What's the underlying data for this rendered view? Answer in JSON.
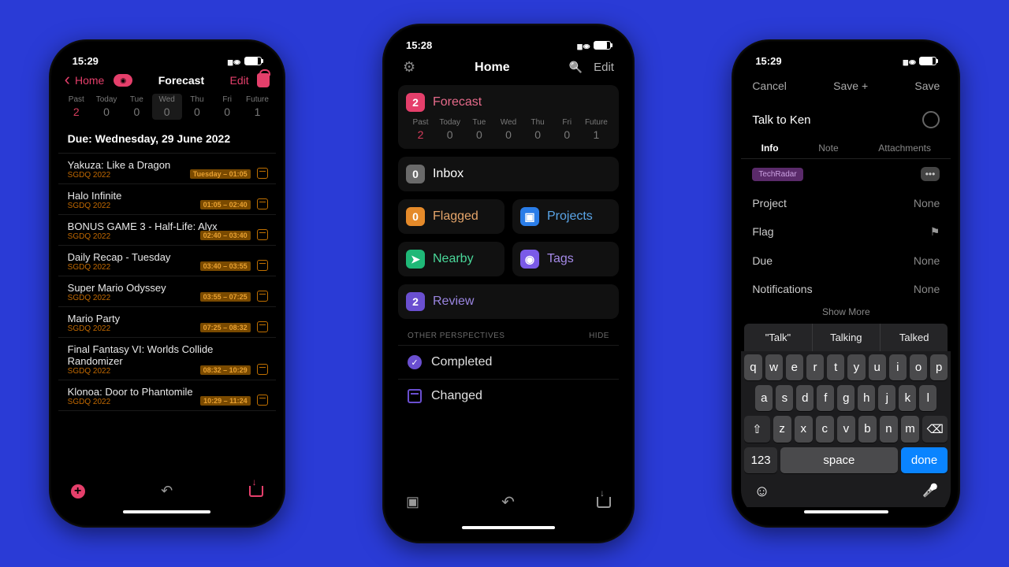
{
  "phone1": {
    "status_time": "15:29",
    "nav": {
      "back": "Home",
      "title": "Forecast",
      "edit": "Edit"
    },
    "days": [
      {
        "label": "Past",
        "num": "2",
        "cls": "past"
      },
      {
        "label": "Today",
        "num": "0"
      },
      {
        "label": "Tue",
        "num": "0"
      },
      {
        "label": "Wed",
        "num": "0",
        "cls": "sel"
      },
      {
        "label": "Thu",
        "num": "0"
      },
      {
        "label": "Fri",
        "num": "0"
      },
      {
        "label": "Future",
        "num": "1"
      }
    ],
    "due_header": "Due: Wednesday, 29 June 2022",
    "tasks": [
      {
        "title": "Yakuza: Like a Dragon",
        "sub": "SGDQ 2022",
        "badge": "Tuesday – 01:05"
      },
      {
        "title": "Halo Infinite",
        "sub": "SGDQ 2022",
        "badge": "01:05 – 02:40"
      },
      {
        "title": "BONUS GAME 3 - Half-Life: Alyx",
        "sub": "SGDQ 2022",
        "badge": "02:40 – 03:40"
      },
      {
        "title": "Daily Recap - Tuesday",
        "sub": "SGDQ 2022",
        "badge": "03:40 – 03:55"
      },
      {
        "title": "Super Mario Odyssey",
        "sub": "SGDQ 2022",
        "badge": "03:55 – 07:25"
      },
      {
        "title": "Mario Party",
        "sub": "SGDQ 2022",
        "badge": "07:25 – 08:32"
      },
      {
        "title": "Final Fantasy VI: Worlds Collide Randomizer",
        "sub": "SGDQ 2022",
        "badge": "08:32 – 10:29"
      },
      {
        "title": "Klonoa: Door to Phantomile",
        "sub": "SGDQ 2022",
        "badge": "10:29 – 11:24"
      }
    ]
  },
  "phone2": {
    "status_time": "15:28",
    "title": "Home",
    "edit": "Edit",
    "forecast": {
      "count": "2",
      "label": "Forecast"
    },
    "days": [
      {
        "label": "Past",
        "num": "2",
        "cls": "past"
      },
      {
        "label": "Today",
        "num": "0"
      },
      {
        "label": "Tue",
        "num": "0"
      },
      {
        "label": "Wed",
        "num": "0"
      },
      {
        "label": "Thu",
        "num": "0"
      },
      {
        "label": "Fri",
        "num": "0"
      },
      {
        "label": "Future",
        "num": "1"
      }
    ],
    "inbox": {
      "count": "0",
      "label": "Inbox"
    },
    "flagged": {
      "count": "0",
      "label": "Flagged"
    },
    "projects": {
      "label": "Projects"
    },
    "nearby": {
      "label": "Nearby"
    },
    "tags": {
      "label": "Tags"
    },
    "review": {
      "count": "2",
      "label": "Review"
    },
    "section": "OTHER PERSPECTIVES",
    "hide": "HIDE",
    "completed": "Completed",
    "changed": "Changed"
  },
  "phone3": {
    "status_time": "15:29",
    "nav": {
      "cancel": "Cancel",
      "saveplus": "Save +",
      "save": "Save"
    },
    "task_title": "Talk to Ken",
    "tabs": {
      "info": "Info",
      "note": "Note",
      "att": "Attachments"
    },
    "tag": "TechRadar",
    "props": {
      "project": {
        "k": "Project",
        "v": "None"
      },
      "flag": {
        "k": "Flag"
      },
      "due": {
        "k": "Due",
        "v": "None"
      },
      "notif": {
        "k": "Notifications",
        "v": "None"
      }
    },
    "show_more": "Show More",
    "suggestions": [
      "\"Talk\"",
      "Talking",
      "Talked"
    ],
    "kb": {
      "r1": [
        "q",
        "w",
        "e",
        "r",
        "t",
        "y",
        "u",
        "i",
        "o",
        "p"
      ],
      "r2": [
        "a",
        "s",
        "d",
        "f",
        "g",
        "h",
        "j",
        "k",
        "l"
      ],
      "r3": [
        "z",
        "x",
        "c",
        "v",
        "b",
        "n",
        "m"
      ],
      "num": "123",
      "space": "space",
      "done": "done"
    }
  }
}
